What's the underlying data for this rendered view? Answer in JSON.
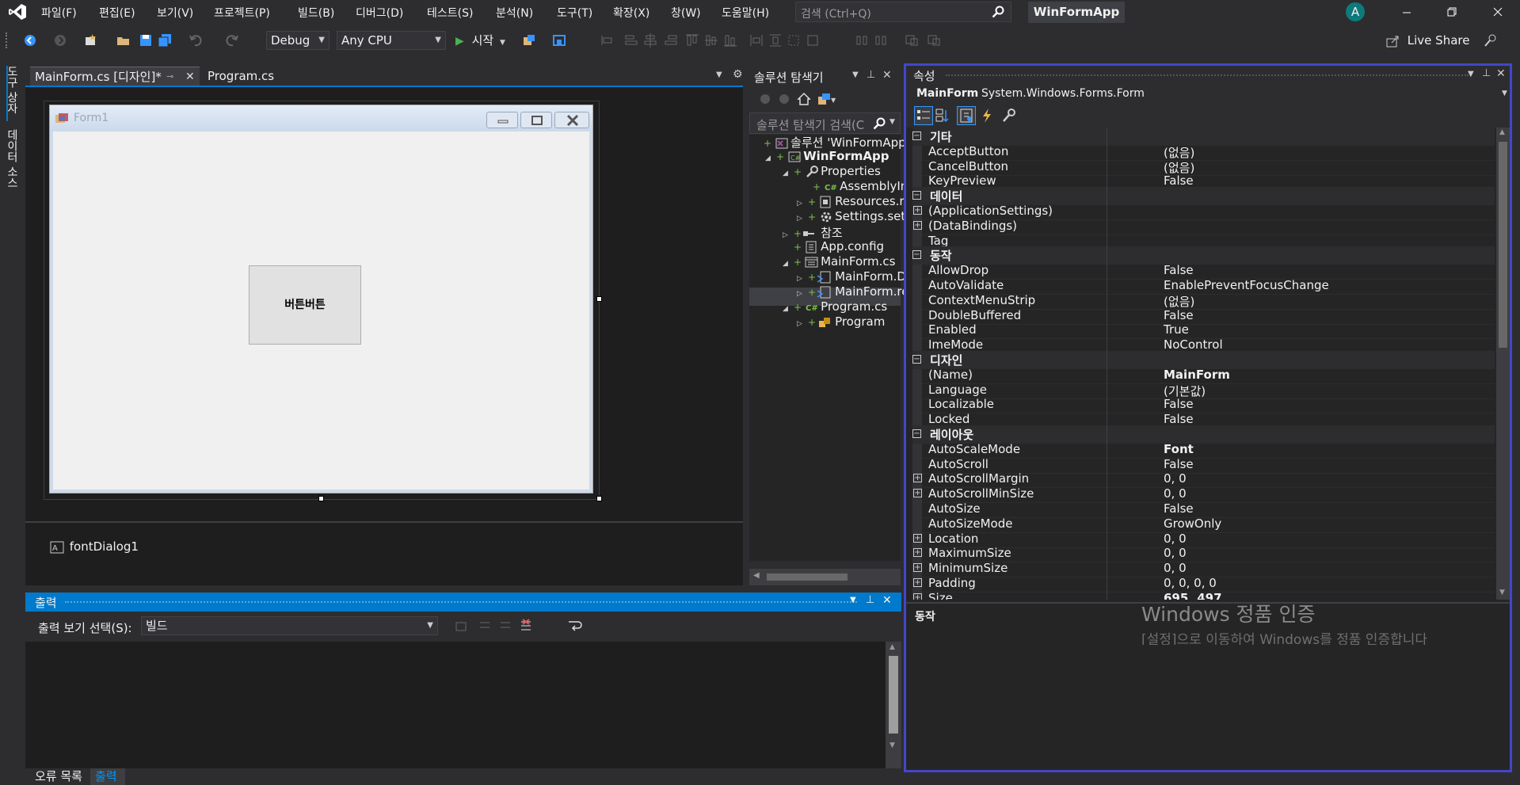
{
  "menu": [
    "파일(F)",
    "편집(E)",
    "보기(V)",
    "프로젝트(P)",
    "빌드(B)",
    "디버그(D)",
    "테스트(S)",
    "분석(N)",
    "도구(T)",
    "확장(X)",
    "창(W)",
    "도움말(H)"
  ],
  "search_placeholder": "검색 (Ctrl+Q)",
  "app_name": "WinFormApp",
  "avatar_letter": "A",
  "toolbar": {
    "config": "Debug",
    "platform": "Any CPU",
    "start": "시작",
    "live_share": "Live Share"
  },
  "side_tabs": [
    "도구 상자",
    "데이터 소스"
  ],
  "doc_tabs": [
    {
      "label": "MainForm.cs [디자인]*"
    },
    {
      "label": "Program.cs"
    }
  ],
  "form": {
    "title": "Form1",
    "button_text": "버튼버튼"
  },
  "tray_component": "fontDialog1",
  "solution_explorer": {
    "title": "솔루션 탐색기",
    "search": "솔루션 탐색기 검색(C",
    "items": [
      {
        "label": "솔루션 'WinFormApp'"
      },
      {
        "label": "WinFormApp"
      },
      {
        "label": "Properties"
      },
      {
        "label": "AssemblyInf"
      },
      {
        "label": "Resources.re"
      },
      {
        "label": "Settings.sett"
      },
      {
        "label": "참조"
      },
      {
        "label": "App.config"
      },
      {
        "label": "MainForm.cs"
      },
      {
        "label": "MainForm.D"
      },
      {
        "label": "MainForm.re"
      },
      {
        "label": "Program.cs"
      },
      {
        "label": "Program"
      }
    ]
  },
  "output": {
    "title": "출력",
    "select_label": "출력 보기 선택(S):",
    "select_value": "빌드"
  },
  "bottom_tabs": [
    "오류 목록",
    "출력"
  ],
  "properties": {
    "title": "속성",
    "object_name": "MainForm",
    "object_type": "System.Windows.Forms.Form",
    "rows": [
      {
        "kind": "cat",
        "name": "기타"
      },
      {
        "kind": "prop",
        "name": "AcceptButton",
        "value": "(없음)"
      },
      {
        "kind": "prop",
        "name": "CancelButton",
        "value": "(없음)"
      },
      {
        "kind": "prop",
        "name": "KeyPreview",
        "value": "False"
      },
      {
        "kind": "cat",
        "name": "데이터"
      },
      {
        "kind": "prop",
        "name": "(ApplicationSettings)",
        "value": "",
        "expandable": true
      },
      {
        "kind": "prop",
        "name": "(DataBindings)",
        "value": "",
        "expandable": true
      },
      {
        "kind": "prop",
        "name": "Tag",
        "value": ""
      },
      {
        "kind": "cat",
        "name": "동작"
      },
      {
        "kind": "prop",
        "name": "AllowDrop",
        "value": "False"
      },
      {
        "kind": "prop",
        "name": "AutoValidate",
        "value": "EnablePreventFocusChange"
      },
      {
        "kind": "prop",
        "name": "ContextMenuStrip",
        "value": "(없음)"
      },
      {
        "kind": "prop",
        "name": "DoubleBuffered",
        "value": "False"
      },
      {
        "kind": "prop",
        "name": "Enabled",
        "value": "True"
      },
      {
        "kind": "prop",
        "name": "ImeMode",
        "value": "NoControl"
      },
      {
        "kind": "cat",
        "name": "디자인"
      },
      {
        "kind": "prop",
        "name": "(Name)",
        "value": "MainForm",
        "bold": true
      },
      {
        "kind": "prop",
        "name": "Language",
        "value": "(기본값)"
      },
      {
        "kind": "prop",
        "name": "Localizable",
        "value": "False"
      },
      {
        "kind": "prop",
        "name": "Locked",
        "value": "False"
      },
      {
        "kind": "cat",
        "name": "레이아웃"
      },
      {
        "kind": "prop",
        "name": "AutoScaleMode",
        "value": "Font",
        "bold": true
      },
      {
        "kind": "prop",
        "name": "AutoScroll",
        "value": "False"
      },
      {
        "kind": "prop",
        "name": "AutoScrollMargin",
        "value": "0, 0",
        "expandable": true
      },
      {
        "kind": "prop",
        "name": "AutoScrollMinSize",
        "value": "0, 0",
        "expandable": true
      },
      {
        "kind": "prop",
        "name": "AutoSize",
        "value": "False"
      },
      {
        "kind": "prop",
        "name": "AutoSizeMode",
        "value": "GrowOnly"
      },
      {
        "kind": "prop",
        "name": "Location",
        "value": "0, 0",
        "expandable": true
      },
      {
        "kind": "prop",
        "name": "MaximumSize",
        "value": "0, 0",
        "expandable": true
      },
      {
        "kind": "prop",
        "name": "MinimumSize",
        "value": "0, 0",
        "expandable": true
      },
      {
        "kind": "prop",
        "name": "Padding",
        "value": "0, 0, 0, 0",
        "expandable": true
      },
      {
        "kind": "prop",
        "name": "Size",
        "value": "695, 497",
        "bold": true,
        "expandable": true
      }
    ],
    "description_title": "동작"
  },
  "watermark": {
    "line1": "Windows 정품 인증",
    "line2": "[설정]으로 이동하여 Windows를 정품 인증합니다"
  }
}
